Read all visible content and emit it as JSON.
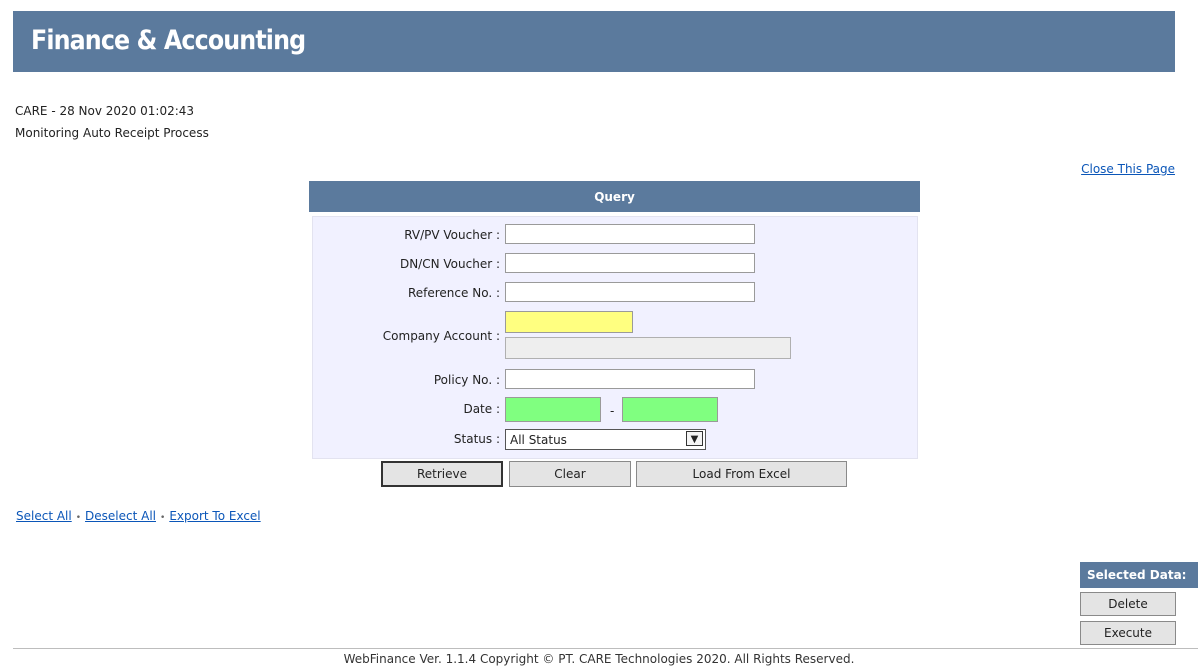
{
  "header": {
    "title": "Finance & Accounting",
    "background": "#5b7a9d"
  },
  "meta": {
    "line1": "CARE - 28 Nov 2020 01:02:43",
    "line2": "Monitoring Auto Receipt Process"
  },
  "close_link": "Close This Page",
  "query": {
    "title": "Query",
    "fields": {
      "rvpv_label": "RV/PV Voucher :",
      "rvpv_value": "",
      "dncn_label": "DN/CN Voucher :",
      "dncn_value": "",
      "reference_label": "Reference No. :",
      "reference_value": "",
      "company_label": "Company Account :",
      "company_code_value": "",
      "company_name_value": "",
      "policy_label": "Policy No. :",
      "policy_value": "",
      "date_label": "Date :",
      "date_from_value": "",
      "date_separator": "-",
      "date_to_value": "",
      "status_label": "Status :",
      "status_value": "All Status"
    },
    "buttons": {
      "retrieve": "Retrieve",
      "clear": "Clear",
      "load_excel": "Load From Excel"
    }
  },
  "actions": {
    "select_all": "Select All",
    "deselect_all": "Deselect All",
    "export_excel": "Export To Excel",
    "separator": "•"
  },
  "selected_data": {
    "title": "Selected Data:",
    "delete": "Delete",
    "execute": "Execute"
  },
  "footer": "WebFinance Ver. 1.1.4 Copyright © PT. CARE Technologies 2020. All Rights Reserved.",
  "colors": {
    "header_bg": "#5b7a9d",
    "panel_bg": "#f1f1ff",
    "required_yellow": "#ffff80",
    "date_green": "#80ff80",
    "link": "#0b56b8"
  }
}
